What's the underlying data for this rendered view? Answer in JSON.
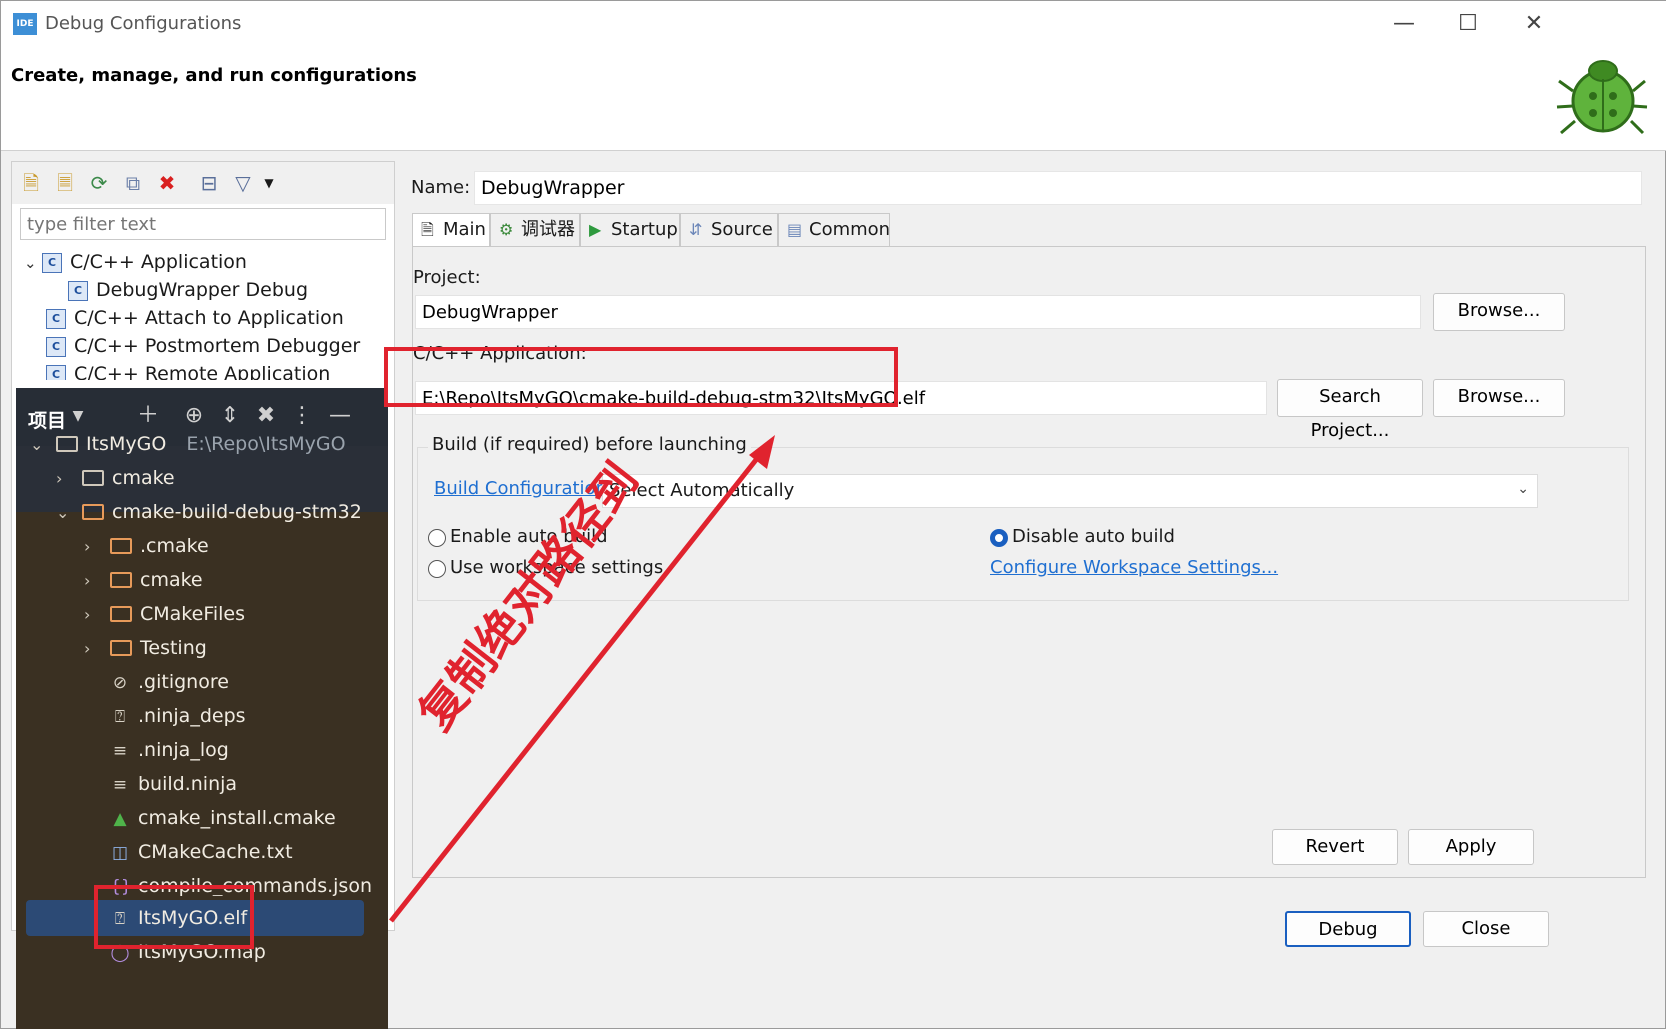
{
  "window": {
    "title": "Debug Configurations",
    "app_icon_text": "IDE",
    "header_title": "Create, manage, and run configurations"
  },
  "left": {
    "filter_placeholder": "type filter text",
    "tree": [
      {
        "label": "C/C++ Application",
        "expanded": true
      },
      {
        "label": "DebugWrapper Debug"
      },
      {
        "label": "C/C++ Attach to Application"
      },
      {
        "label": "C/C++ Postmortem Debugger"
      },
      {
        "label": "C/C++ Remote Application"
      }
    ]
  },
  "project_panel": {
    "title": "项目",
    "root_name": "ItsMyGO",
    "root_path": "E:\\Repo\\ItsMyGO",
    "items": [
      "cmake",
      "cmake-build-debug-stm32",
      ".cmake",
      "cmake",
      "CMakeFiles",
      "Testing",
      ".gitignore",
      ".ninja_deps",
      ".ninja_log",
      "build.ninja",
      "cmake_install.cmake",
      "CMakeCache.txt",
      "compile_commands.json",
      "ItsMyGO.elf",
      "ItsMyGO.map"
    ]
  },
  "right": {
    "name_label": "Name:",
    "name_value": "DebugWrapper",
    "tabs": [
      "Main",
      "调试器",
      "Startup",
      "Source",
      "Common"
    ],
    "project_label": "Project:",
    "project_value": "DebugWrapper",
    "browse_label": "Browse...",
    "app_label": "C/C++ Application:",
    "app_value": "E:\\Repo\\ItsMyGO\\cmake-build-debug-stm32\\ItsMyGO.elf",
    "search_project_label": "Search Project...",
    "build_group_label": "Build (if required) before launching",
    "build_config_link": "Build Configuration:",
    "build_config_value": "Select Automatically",
    "enable_auto_build": "Enable auto build",
    "disable_auto_build": "Disable auto build",
    "use_workspace": "Use workspace settings",
    "configure_workspace_link": "Configure Workspace Settings...",
    "revert_label": "Revert",
    "apply_label": "Apply",
    "debug_label": "Debug",
    "close_label": "Close"
  },
  "annotation": {
    "text": "复制绝对路径到",
    "color": "#e0232e"
  }
}
